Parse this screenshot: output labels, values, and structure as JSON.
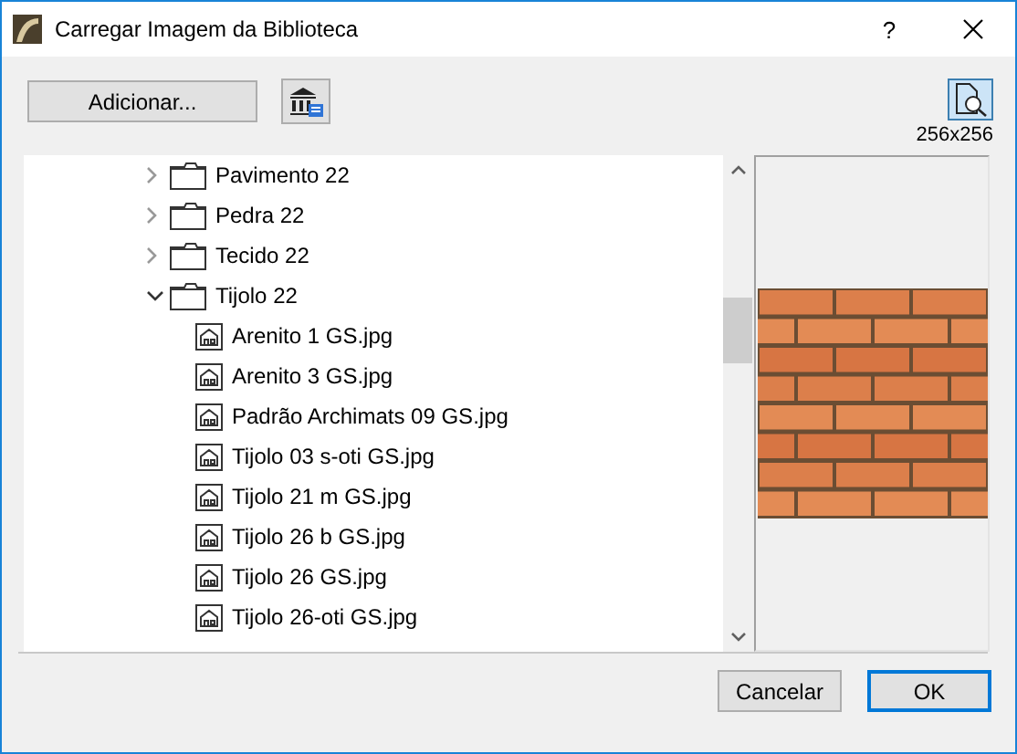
{
  "window": {
    "title": "Carregar Imagem da Biblioteca",
    "help": "?"
  },
  "toolbar": {
    "add_button": "Adicionar...",
    "preview_toggle": {
      "on": true
    },
    "resolution": "256x256"
  },
  "tree": {
    "items": [
      {
        "kind": "folder",
        "label": "Pavimento 22",
        "expanded": false
      },
      {
        "kind": "folder",
        "label": "Pedra 22",
        "expanded": false
      },
      {
        "kind": "folder",
        "label": "Tecido 22",
        "expanded": false
      },
      {
        "kind": "folder",
        "label": "Tijolo 22",
        "expanded": true,
        "children": [
          {
            "kind": "image",
            "label": "Arenito 1 GS.jpg"
          },
          {
            "kind": "image",
            "label": "Arenito 3 GS.jpg"
          },
          {
            "kind": "image",
            "label": "Padrão Archimats 09 GS.jpg"
          },
          {
            "kind": "image",
            "label": "Tijolo 03 s-oti GS.jpg"
          },
          {
            "kind": "image",
            "label": "Tijolo 21 m GS.jpg"
          },
          {
            "kind": "image",
            "label": "Tijolo 26 b GS.jpg"
          },
          {
            "kind": "image",
            "label": "Tijolo 26 GS.jpg"
          },
          {
            "kind": "image",
            "label": "Tijolo 26-oti GS.jpg"
          }
        ]
      }
    ]
  },
  "buttons": [
    {
      "label": "Cancelar",
      "default": false
    },
    {
      "label": "OK",
      "default": true
    }
  ]
}
